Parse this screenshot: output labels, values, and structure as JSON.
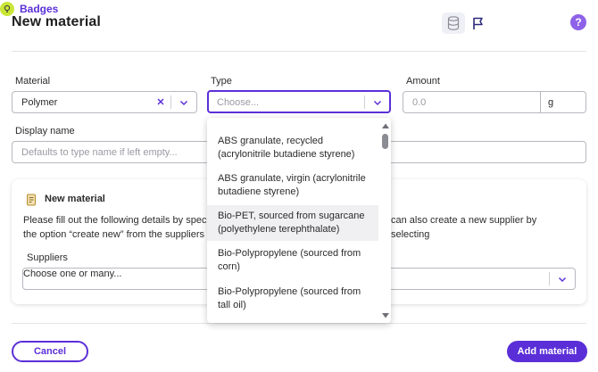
{
  "header": {
    "title": "New material",
    "badges_label": "Badges",
    "help_label": "?"
  },
  "form": {
    "material": {
      "label": "Material",
      "value": "Polymer"
    },
    "type": {
      "label": "Type",
      "placeholder": "Choose..."
    },
    "amount": {
      "label": "Amount",
      "placeholder": "0.0",
      "unit": "g"
    },
    "display_name": {
      "label": "Display name",
      "placeholder": "Defaults to type name if left empty..."
    }
  },
  "info_card": {
    "title": "New material",
    "text_left_1": "Please fill out the following details by spec",
    "text_right_1": "can also create a new supplier by selecting",
    "text_left_2": "the option “create new” from the suppliers",
    "suppliers_label": "Suppliers",
    "suppliers_placeholder": "Choose one or many..."
  },
  "dropdown": {
    "options": [
      {
        "line1": "ABS granulate, recycled",
        "line2": "(acrylonitrile butadiene styrene)"
      },
      {
        "line1": "ABS granulate, virgin (acrylonitrile",
        "line2": "butadiene styrene)"
      },
      {
        "line1": "Bio-PET, sourced from sugarcane",
        "line2": "(polyethylene terephthalate)"
      },
      {
        "line1": "Bio-Polypropylene (sourced from",
        "line2": "corn)"
      },
      {
        "line1": "Bio-Polypropylene (sourced from",
        "line2": "tall oil)"
      }
    ],
    "highlighted_index": 2
  },
  "footer": {
    "cancel_label": "Cancel",
    "submit_label": "Add material"
  },
  "colors": {
    "accent": "#5b2fd8",
    "badge": "#c9e636",
    "help": "#8e62e8"
  }
}
